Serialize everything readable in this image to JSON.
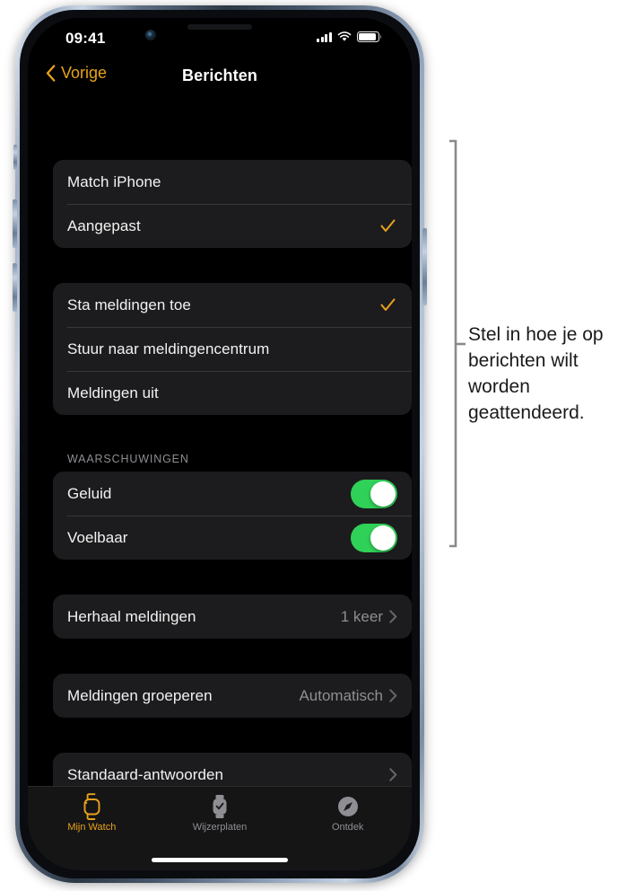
{
  "statusbar": {
    "time": "09:41",
    "cellular_icon": "cellular-signal-icon",
    "wifi_icon": "wifi-icon",
    "battery_icon": "battery-icon"
  },
  "navbar": {
    "back_label": "Vorige",
    "back_icon": "chevron-left-icon",
    "title": "Berichten"
  },
  "colors": {
    "accent": "#E9A21A",
    "toggle_on": "#30D158",
    "card_bg": "#1C1C1E",
    "screen_bg": "#000000",
    "secondary_text": "#8E8E93"
  },
  "groups": [
    {
      "name": "alert-style-group",
      "rows": [
        {
          "label": "Match iPhone",
          "type": "choice",
          "checked": false
        },
        {
          "label": "Aangepast",
          "type": "choice",
          "checked": true
        }
      ]
    },
    {
      "name": "notification-delivery-group",
      "rows": [
        {
          "label": "Sta meldingen toe",
          "type": "choice",
          "checked": true
        },
        {
          "label": "Stuur naar meldingencentrum",
          "type": "choice",
          "checked": false
        },
        {
          "label": "Meldingen uit",
          "type": "choice",
          "checked": false
        }
      ]
    },
    {
      "name": "alerts-group",
      "header": "WAARSCHUWINGEN",
      "rows": [
        {
          "label": "Geluid",
          "type": "toggle",
          "on": true
        },
        {
          "label": "Voelbaar",
          "type": "toggle",
          "on": true
        }
      ]
    },
    {
      "name": "repeat-alerts-group",
      "rows": [
        {
          "label": "Herhaal meldingen",
          "type": "disclosure",
          "value": "1 keer"
        }
      ]
    },
    {
      "name": "group-notifications-group",
      "rows": [
        {
          "label": "Meldingen groeperen",
          "type": "disclosure",
          "value": "Automatisch"
        }
      ]
    },
    {
      "name": "default-replies-group",
      "rows": [
        {
          "label": "Standaard-antwoorden",
          "type": "disclosure",
          "value": ""
        }
      ]
    }
  ],
  "tabbar": {
    "tabs": [
      {
        "label": "Mijn Watch",
        "icon": "watch-icon",
        "active": true
      },
      {
        "label": "Wijzerplaten",
        "icon": "watch-face-icon",
        "active": false
      },
      {
        "label": "Ontdek",
        "icon": "compass-icon",
        "active": false
      }
    ]
  },
  "callout": {
    "text": "Stel in hoe je op berichten wilt worden geattendeerd."
  }
}
